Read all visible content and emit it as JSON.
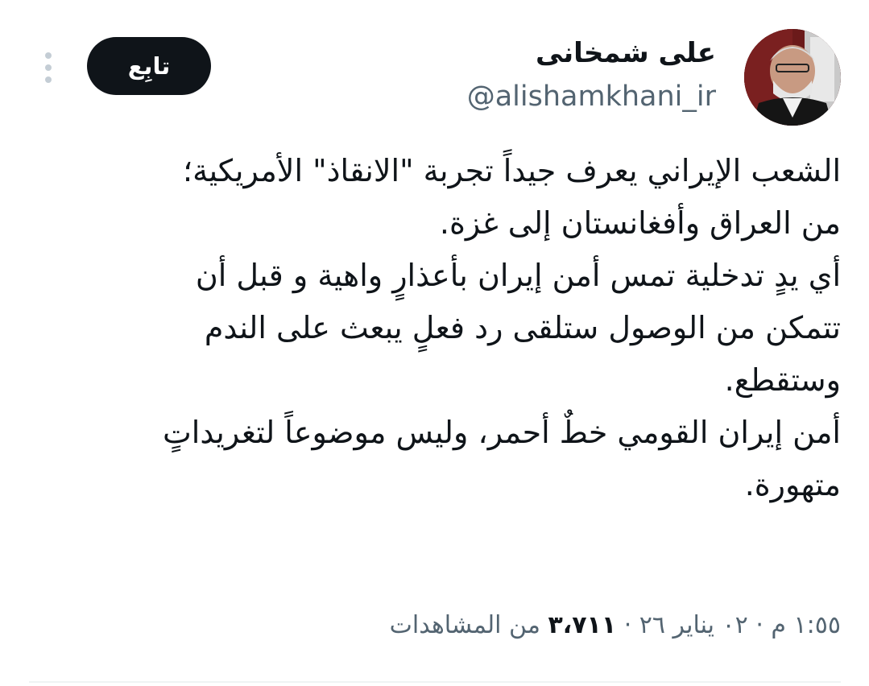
{
  "tweet": {
    "author_name": "علی شمخانی",
    "author_handle": "@alishamkhani_ir",
    "follow_label": "تابِع",
    "paragraphs": [
      "الشعب الإيراني يعرف جيداً تجربة \"الانقاذ\" الأمريكية؛\nمن العراق وأفغانستان إلى غزة.",
      "أي يدٍ تدخلية تمس أمن إيران بأعذارٍ واهية و قبل أن\nتتمكن من الوصول ستلقى رد فعلٍ يبعث على الندم\nوستقطع.",
      "أمن إيران القومي خطٌ أحمر، وليس موضوعاً لتغريداتٍ\nمتهورة."
    ],
    "time": "١:٥٥ م",
    "date": "٠٢ يناير ٢٦",
    "views_count": "٣،٧١١",
    "views_label": "من المشاهدات",
    "separator": "·"
  },
  "icons": {
    "more": "more-vertical-icon",
    "avatar": "profile-photo"
  },
  "colors": {
    "text_primary": "#0f1419",
    "text_secondary": "#536471",
    "button_bg": "#0f1419",
    "button_text": "#ffffff"
  }
}
